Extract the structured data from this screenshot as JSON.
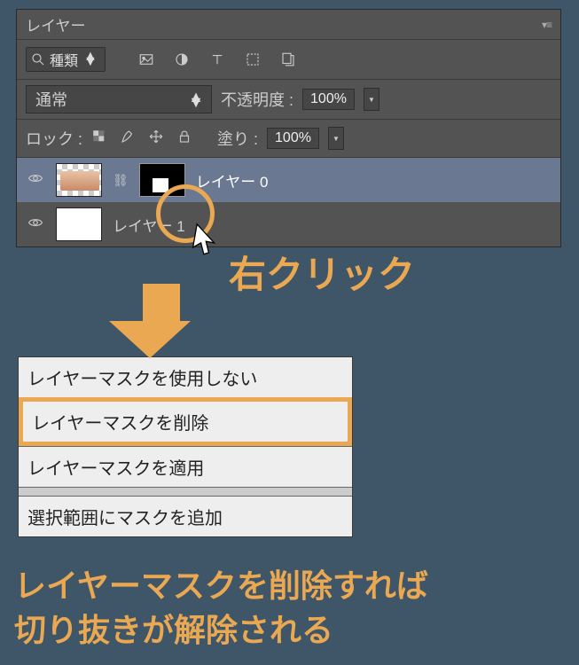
{
  "panel": {
    "title": "レイヤー",
    "filter_label": "種類",
    "blend_mode": "通常",
    "opacity_label": "不透明度 :",
    "opacity_value": "100%",
    "lock_label": "ロック :",
    "fill_label": "塗り :",
    "fill_value": "100%"
  },
  "layers": [
    {
      "name": "レイヤー 0",
      "selected": true
    },
    {
      "name": "レイヤー 1",
      "selected": false
    }
  ],
  "annotation": {
    "right_click": "右クリック"
  },
  "context_menu": {
    "items": [
      "レイヤーマスクを使用しない",
      "レイヤーマスクを削除",
      "レイヤーマスクを適用",
      "選択範囲にマスクを追加"
    ],
    "highlighted_index": 1
  },
  "caption": {
    "line1": "レイヤーマスクを削除すれば",
    "line2": "切り抜きが解除される"
  },
  "colors": {
    "accent": "#e9a851",
    "panel_bg": "#535353",
    "page_bg": "#3e5668"
  }
}
